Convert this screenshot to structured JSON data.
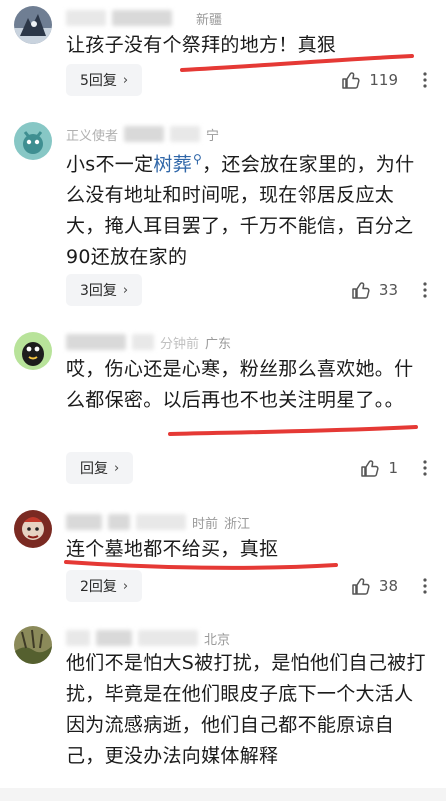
{
  "comments": [
    {
      "location": "新疆",
      "text": "让孩子没有个祭拜的地方！真狠",
      "replies": "5回复",
      "likes": "119"
    },
    {
      "name_fragment": "正义使者",
      "location": "宁",
      "text_pre": "小s不一定",
      "text_link": "树葬",
      "text_post": "，还会放在家里的，为什么没有地址和时间呢，现在邻居反应太大，掩人耳目罢了，千万不能信，百分之90还放在家的",
      "replies": "3回复",
      "likes": "33"
    },
    {
      "time_fragment": "分钟前",
      "location": "广东",
      "text": "哎，伤心还是心寒，粉丝那么喜欢她。什么都保密。以后再也不也关注明星了。。",
      "replies": "回复",
      "likes": "1"
    },
    {
      "time_fragment": "时前",
      "location": "浙江",
      "text": "连个墓地都不给买，真抠",
      "replies": "2回复",
      "likes": "38"
    },
    {
      "location": "北京",
      "text": "他们不是怕大S被打扰，是怕他们自己被打扰，毕竟是在他们眼皮子底下一个大活人因为流感病逝，他们自己都不能原谅自己，更没办法向媒体解释"
    }
  ],
  "colors": {
    "underline": "#e53935",
    "link": "#2f66a8",
    "pill_bg": "#f3f4f6"
  }
}
